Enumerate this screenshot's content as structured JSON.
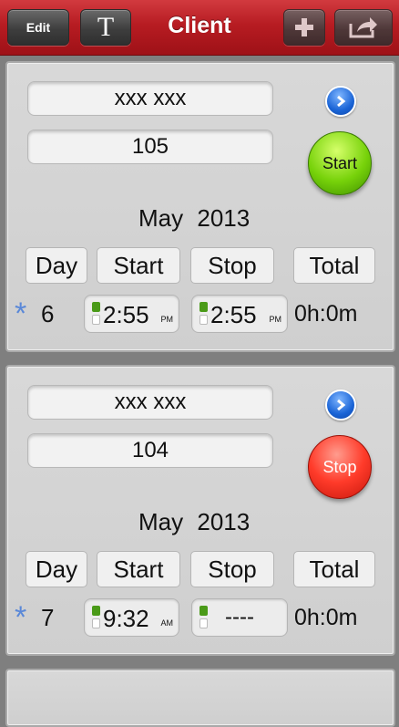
{
  "nav": {
    "edit_label": "Edit",
    "text_label": "T",
    "title": "Client",
    "plus_icon": "plus-icon",
    "share_icon": "share-icon"
  },
  "cards": [
    {
      "name": "xxx xxx",
      "number": "105",
      "action": "Start",
      "month": "May",
      "year": "2013",
      "headers": {
        "day": "Day",
        "start": "Start",
        "stop": "Stop",
        "total": "Total"
      },
      "star": "*",
      "day": "6",
      "start_time": "2:55",
      "start_ampm": "PM",
      "stop_time": "2:55",
      "stop_ampm": "PM",
      "total": "0h:0m"
    },
    {
      "name": "xxx xxx",
      "number": "104",
      "action": "Stop",
      "month": "May",
      "year": "2013",
      "headers": {
        "day": "Day",
        "start": "Start",
        "stop": "Stop",
        "total": "Total"
      },
      "star": "*",
      "day": "7",
      "start_time": "9:32",
      "start_ampm": "AM",
      "stop_time": "----",
      "total": "0h:0m"
    }
  ],
  "colors": {
    "navbar": "#b71c22",
    "start_button": "#77d20a",
    "stop_button": "#ff3b2a",
    "star": "#5a88d8"
  }
}
